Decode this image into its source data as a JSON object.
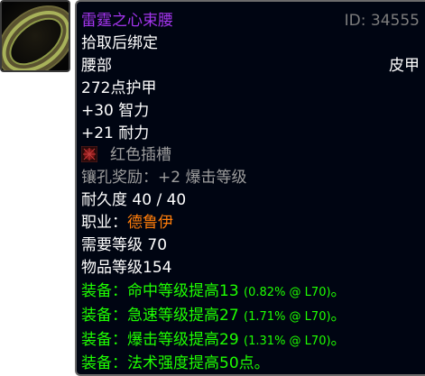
{
  "item": {
    "name": "雷霆之心束腰",
    "id": "ID: 34555",
    "bind": "拾取后绑定",
    "slot": "腰部",
    "armor_type": "皮甲",
    "armor": "272点护甲",
    "stat_1": "+30 智力",
    "stat_2": "+21 耐力",
    "socket": "红色插槽",
    "socket_bonus": "镶孔奖励：+2 爆击等级",
    "durability": "耐久度 40 / 40",
    "class_label": "职业：",
    "class_value": "德鲁伊",
    "required_level": "需要等级 70",
    "item_level": "物品等级154",
    "equip_effects": [
      {
        "prefix": "装备：",
        "text": "命中等级提高13",
        "detail": "(0.82% @ L70)",
        "suffix": "。"
      },
      {
        "prefix": "装备：",
        "text": "急速等级提高27",
        "detail": "(1.71% @ L70)",
        "suffix": "。"
      },
      {
        "prefix": "装备：",
        "text": "爆击等级提高29",
        "detail": "(1.31% @ L70)",
        "suffix": "。"
      },
      {
        "prefix": "装备：",
        "text": "法术强度提高50点。",
        "detail": "",
        "suffix": ""
      }
    ]
  },
  "colors": {
    "epic": "#a335ee",
    "class_druid": "#ff7d0a",
    "equip_green": "#1eff00",
    "disabled_gray": "#9d9d9d"
  },
  "icons": {
    "item_icon": "belt-icon",
    "socket_icon": "red-socket-icon"
  }
}
